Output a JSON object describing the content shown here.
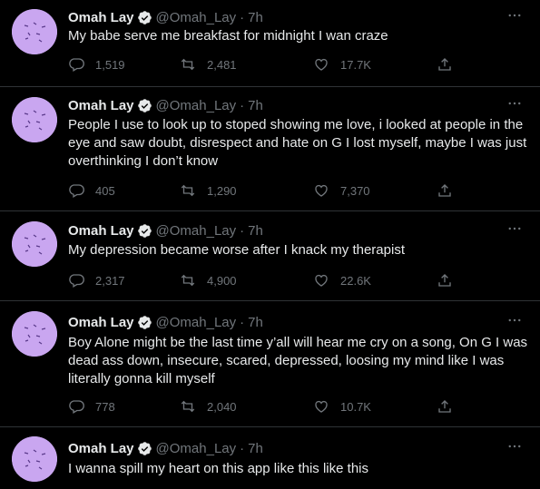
{
  "tweets": [
    {
      "name": "Omah Lay",
      "handle": "@Omah_Lay",
      "sep": "·",
      "time": "7h",
      "text": "My babe serve me breakfast for midnight I wan craze",
      "replies": "1,519",
      "retweets": "2,481",
      "likes": "17.7K"
    },
    {
      "name": "Omah Lay",
      "handle": "@Omah_Lay",
      "sep": "·",
      "time": "7h",
      "text": "People I use to look up to stoped showing me love, i looked at people in the eye and saw doubt, disrespect and hate on G I lost myself, maybe I was just overthinking I don’t know",
      "replies": "405",
      "retweets": "1,290",
      "likes": "7,370"
    },
    {
      "name": "Omah Lay",
      "handle": "@Omah_Lay",
      "sep": "·",
      "time": "7h",
      "text": "My depression became worse after I knack my therapist",
      "replies": "2,317",
      "retweets": "4,900",
      "likes": "22.6K"
    },
    {
      "name": "Omah Lay",
      "handle": "@Omah_Lay",
      "sep": "·",
      "time": "7h",
      "text": "Boy Alone might be the last time y’all will hear me cry on a song, On G I was dead ass down, insecure, scared, depressed, loosing my mind like I was literally gonna kill myself",
      "replies": "778",
      "retweets": "2,040",
      "likes": "10.7K"
    },
    {
      "name": "Omah Lay",
      "handle": "@Omah_Lay",
      "sep": "·",
      "time": "7h",
      "text": "I wanna spill my heart on this app like this like this"
    }
  ],
  "icons": {
    "reply": "reply-icon",
    "retweet": "retweet-icon",
    "like": "heart-icon",
    "share": "share-icon",
    "more": "more-icon",
    "verified": "verified-icon"
  },
  "colors": {
    "background": "#000000",
    "text": "#e7e9ea",
    "muted": "#71767b",
    "divider": "#2f3336",
    "avatar": "#c9a6f0"
  }
}
